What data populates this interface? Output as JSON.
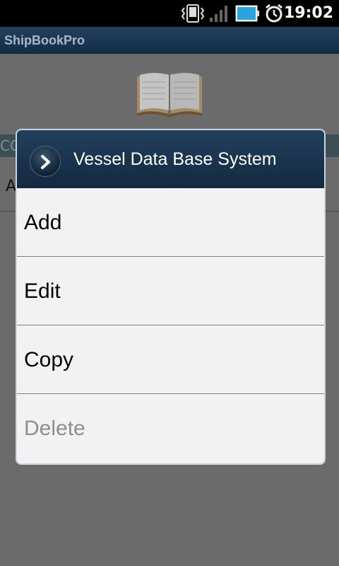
{
  "status_bar": {
    "time": "19:02",
    "icons": [
      "vibrate-icon",
      "signal-icon",
      "battery-icon",
      "alarm-icon"
    ]
  },
  "app": {
    "title": "ShipBookPro"
  },
  "background": {
    "section_label": "CO",
    "row_label": "A"
  },
  "dialog": {
    "title": "Vessel Data Base System",
    "header_icon": "chevron-right-icon",
    "items": [
      {
        "label": "Add",
        "enabled": true
      },
      {
        "label": "Edit",
        "enabled": true
      },
      {
        "label": "Copy",
        "enabled": true
      },
      {
        "label": "Delete",
        "enabled": false
      }
    ]
  },
  "colors": {
    "header": "#1b3550",
    "dim_background": "#6b6b6b",
    "dialog_body": "#f2f2f2",
    "disabled_text": "#8e8e8e"
  }
}
